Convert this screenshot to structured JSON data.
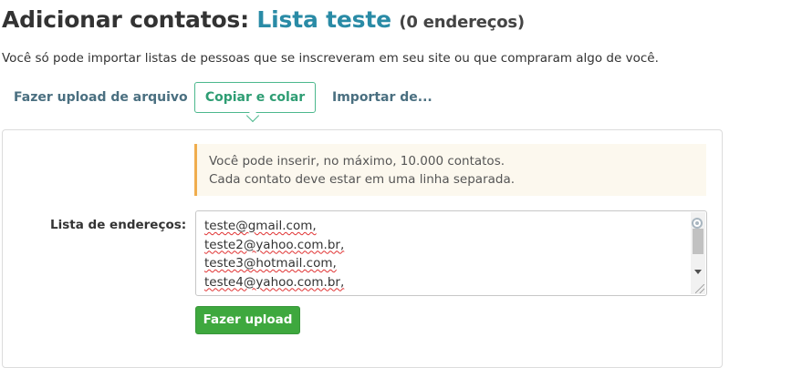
{
  "header": {
    "title_prefix": "Adicionar contatos:",
    "list_name": "Lista teste",
    "count_label": "(0 endereços)"
  },
  "intro_text": "Você só pode importar listas de pessoas que se inscreveram em seu site ou que compraram algo de você.",
  "tabs": [
    {
      "label": "Fazer upload de arquivo",
      "active": false
    },
    {
      "label": "Copiar e colar",
      "active": true
    },
    {
      "label": "Importar de...",
      "active": false
    }
  ],
  "notice": {
    "line1": "Você pode inserir, no máximo, 10.000 contatos.",
    "line2": "Cada contato deve estar em uma linha separada."
  },
  "form": {
    "field_label": "Lista de endereços:",
    "textarea_lines": [
      "teste@gmail.com,",
      "teste2@yahoo.com.br,",
      "teste3@hotmail.com,",
      "teste4@yahoo.com.br,"
    ],
    "submit_label": "Fazer upload"
  },
  "colors": {
    "list_name": "#2a8ba6",
    "active_tab_border": "#4cb88d",
    "notice_border": "#f0ad4e",
    "button_bg": "#3ea83e"
  },
  "icons": [
    "grammar-check-icon",
    "scroll-down-arrow-icon",
    "resize-grip-icon"
  ]
}
